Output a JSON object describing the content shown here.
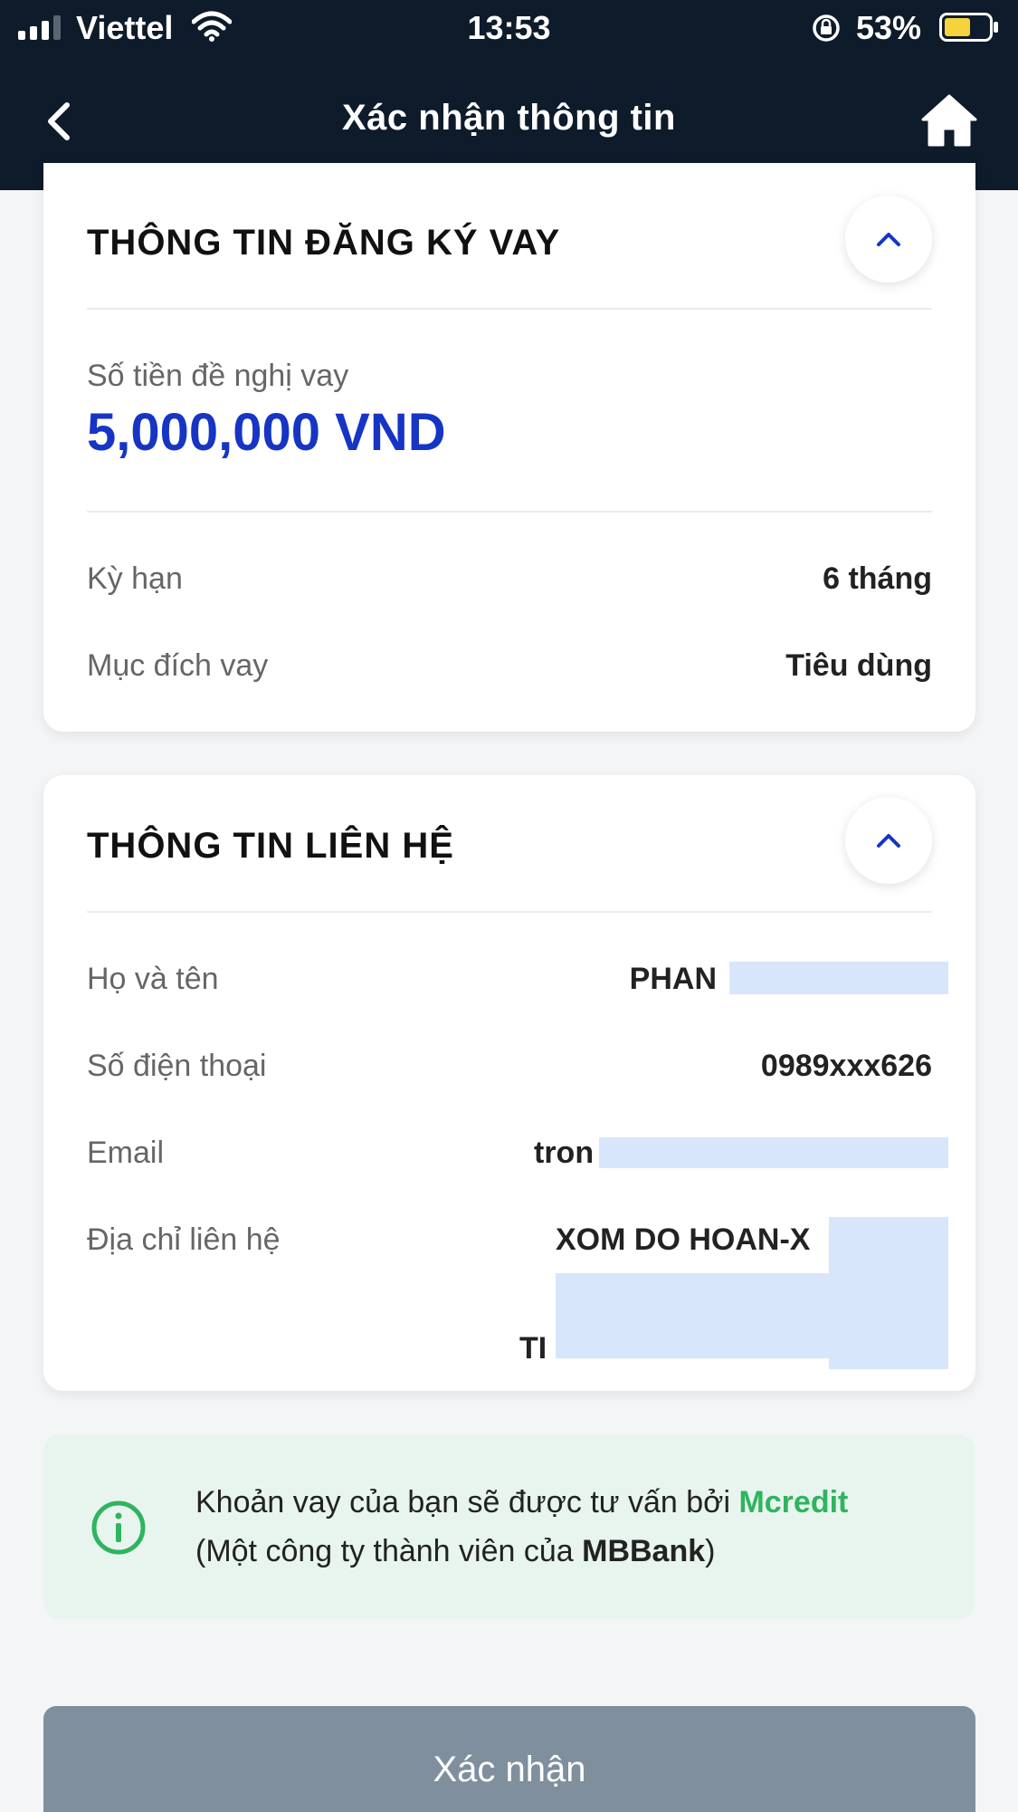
{
  "status_bar": {
    "carrier": "Viettel",
    "time": "13:53",
    "battery_percent": "53%"
  },
  "nav": {
    "title": "Xác nhận thông tin",
    "back_icon": "chevron-left-icon",
    "home_icon": "home-icon"
  },
  "loan_section": {
    "title": "THÔNG TIN ĐĂNG KÝ VAY",
    "amount_label": "Số tiền đề nghị vay",
    "amount_value": "5,000,000 VND",
    "term_label": "Kỳ hạn",
    "term_value": "6 tháng",
    "purpose_label": "Mục đích vay",
    "purpose_value": "Tiêu dùng"
  },
  "contact_section": {
    "title": "THÔNG TIN LIÊN HỆ",
    "name_label": "Họ và tên",
    "name_value": "PHAN",
    "phone_label": "Số điện thoại",
    "phone_value": "0989xxx626",
    "email_label": "Email",
    "email_value": "tron",
    "address_label": "Địa chỉ liên hệ",
    "address_line1": "XOM DO HOAN-X",
    "address_line3": "TI"
  },
  "info": {
    "line1_prefix": "Khoản vay của bạn sẽ được tư vấn bởi ",
    "line1_brand": "Mcredit",
    "line2_prefix": "(Một công ty thành viên của ",
    "line2_brand": "MBBank",
    "line2_suffix": ")"
  },
  "confirm_button": {
    "label": "Xác nhận"
  },
  "colors": {
    "header_bg": "#0e1b2b",
    "amount_blue": "#1735c4",
    "mcredit_green": "#2fb45f",
    "button_grey": "#7f8f9d",
    "info_bg": "#e8f5ee"
  }
}
